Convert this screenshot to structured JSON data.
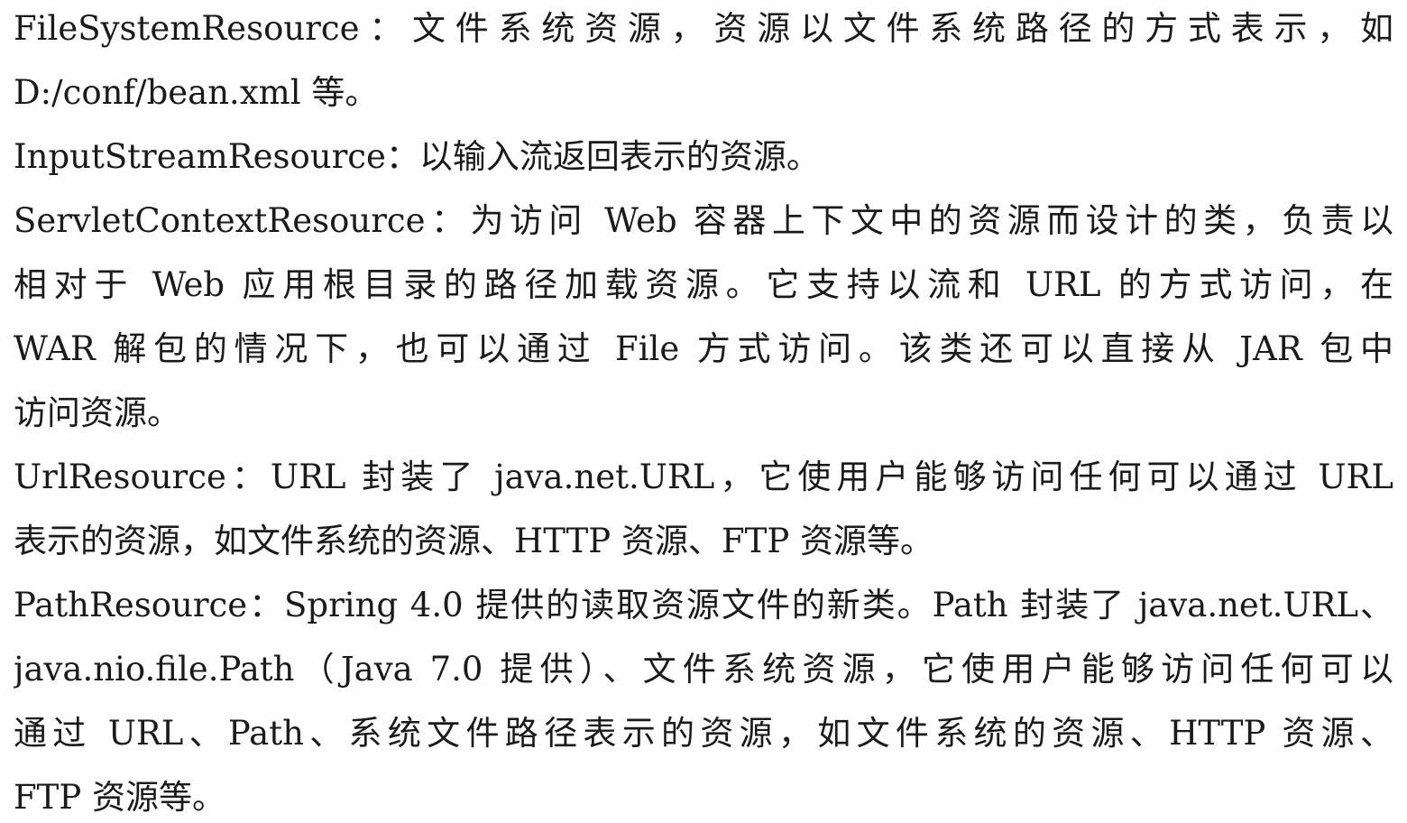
{
  "document": {
    "lines": [
      "FileSystemResource：文件系统资源，资源以文件系统路径的方式表示，如",
      "D:/conf/bean.xml 等。",
      "InputStreamResource：以输入流返回表示的资源。",
      "ServletContextResource：为访问 Web 容器上下文中的资源而设计的类，负责以",
      "相对于 Web 应用根目录的路径加载资源。它支持以流和 URL 的方式访问，在",
      "WAR 解包的情况下，也可以通过 File 方式访问。该类还可以直接从 JAR 包中",
      "访问资源。",
      "UrlResource：URL 封装了 java.net.URL，它使用户能够访问任何可以通过 URL",
      "表示的资源，如文件系统的资源、HTTP 资源、FTP 资源等。",
      "PathResource：Spring 4.0 提供的读取资源文件的新类。Path 封装了 java.net.URL、",
      "java.nio.file.Path（Java 7.0 提供）、文件系统资源，它使用户能够访问任何可以",
      "通过 URL、Path、系统文件路径表示的资源，如文件系统的资源、HTTP 资源、",
      "FTP 资源等。"
    ]
  }
}
